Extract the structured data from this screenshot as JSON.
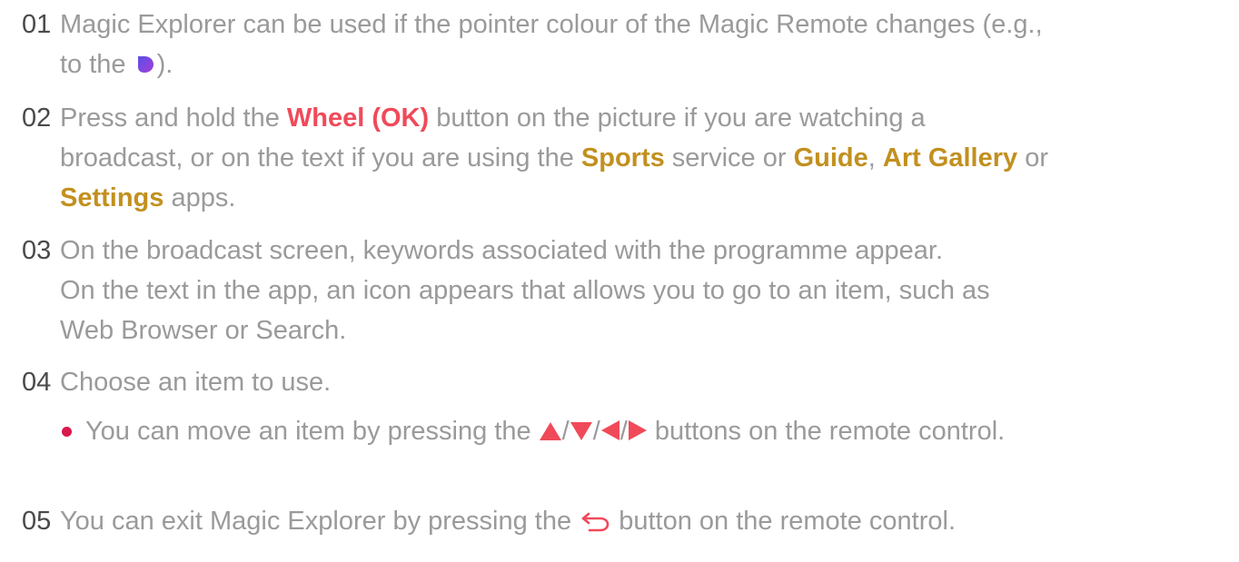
{
  "steps": [
    {
      "number": "01",
      "text_a": "Magic Explorer can be used if the pointer colour of the Magic Remote changes (e.g.,",
      "text_b": "to the",
      "text_c": ")."
    },
    {
      "number": "02",
      "text_a": "Press and hold the ",
      "wheel_label": "Wheel (OK)",
      "text_b": " button on the picture if you are watching a",
      "text_c": "broadcast, or on the text if you are using the ",
      "sports_label": "Sports",
      "text_d": " service or ",
      "guide_label": "Guide",
      "text_e": ", ",
      "art_gallery_label": "Art Gallery",
      "text_f": " or",
      "settings_label": "Settings",
      "text_g": " apps."
    },
    {
      "number": "03",
      "line1": "On the broadcast screen, keywords associated with the programme appear.",
      "line2": "On the text in the app, an icon appears that allows you to go to an item, such as",
      "line3": "Web Browser or Search."
    },
    {
      "number": "04",
      "text": "Choose an item to use.",
      "bullet_a": "You can move an item by pressing the ",
      "sep": "/",
      "bullet_b": " buttons on the remote control."
    },
    {
      "number": "05",
      "text_a": "You can exit Magic Explorer by pressing the ",
      "text_b": " button on the remote control."
    }
  ],
  "icons": {
    "pointer": "purple-pointer-icon",
    "up": "up-arrow-icon",
    "down": "down-arrow-icon",
    "left": "left-arrow-icon",
    "right": "right-arrow-icon",
    "back": "back-icon"
  },
  "colors": {
    "text": "#9a9a9a",
    "number": "#4a4a4a",
    "highlight_red": "#f04a5a",
    "highlight_gold": "#c2901f",
    "arrow_red": "#f04a5a",
    "pointer_purple": "#7b3fe0",
    "bullet": "#d81a4c"
  }
}
